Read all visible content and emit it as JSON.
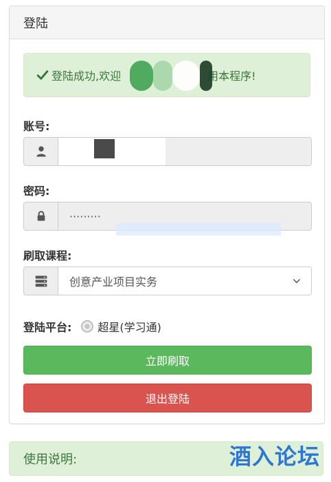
{
  "panel": {
    "title": "登陆"
  },
  "alert": {
    "message_start": "登陆成功,欢迎",
    "message_end": "用本程序!"
  },
  "account": {
    "label": "账号:",
    "value": ""
  },
  "password": {
    "label": "密码:",
    "value": "·········"
  },
  "course": {
    "label": "刷取课程:",
    "selected": "创意产业项目实务"
  },
  "platform": {
    "label": "登陆平台:",
    "option": "超星(学习通)"
  },
  "buttons": {
    "start_label": "立即刷取",
    "logout_label": "退出登陆"
  },
  "instructions": {
    "title": "使用说明:"
  },
  "watermark": {
    "text": "酒入论坛"
  },
  "colors": {
    "success_bg": "#dff0d8",
    "success_text": "#3c763d",
    "green_button": "#5cb85c",
    "red_button": "#d9534f",
    "watermark_blue": "#2e77d0"
  },
  "icons": {
    "alert": "check-icon",
    "account": "user-icon",
    "password": "lock-icon",
    "course": "server-icon",
    "select": "chevron-down-icon"
  }
}
